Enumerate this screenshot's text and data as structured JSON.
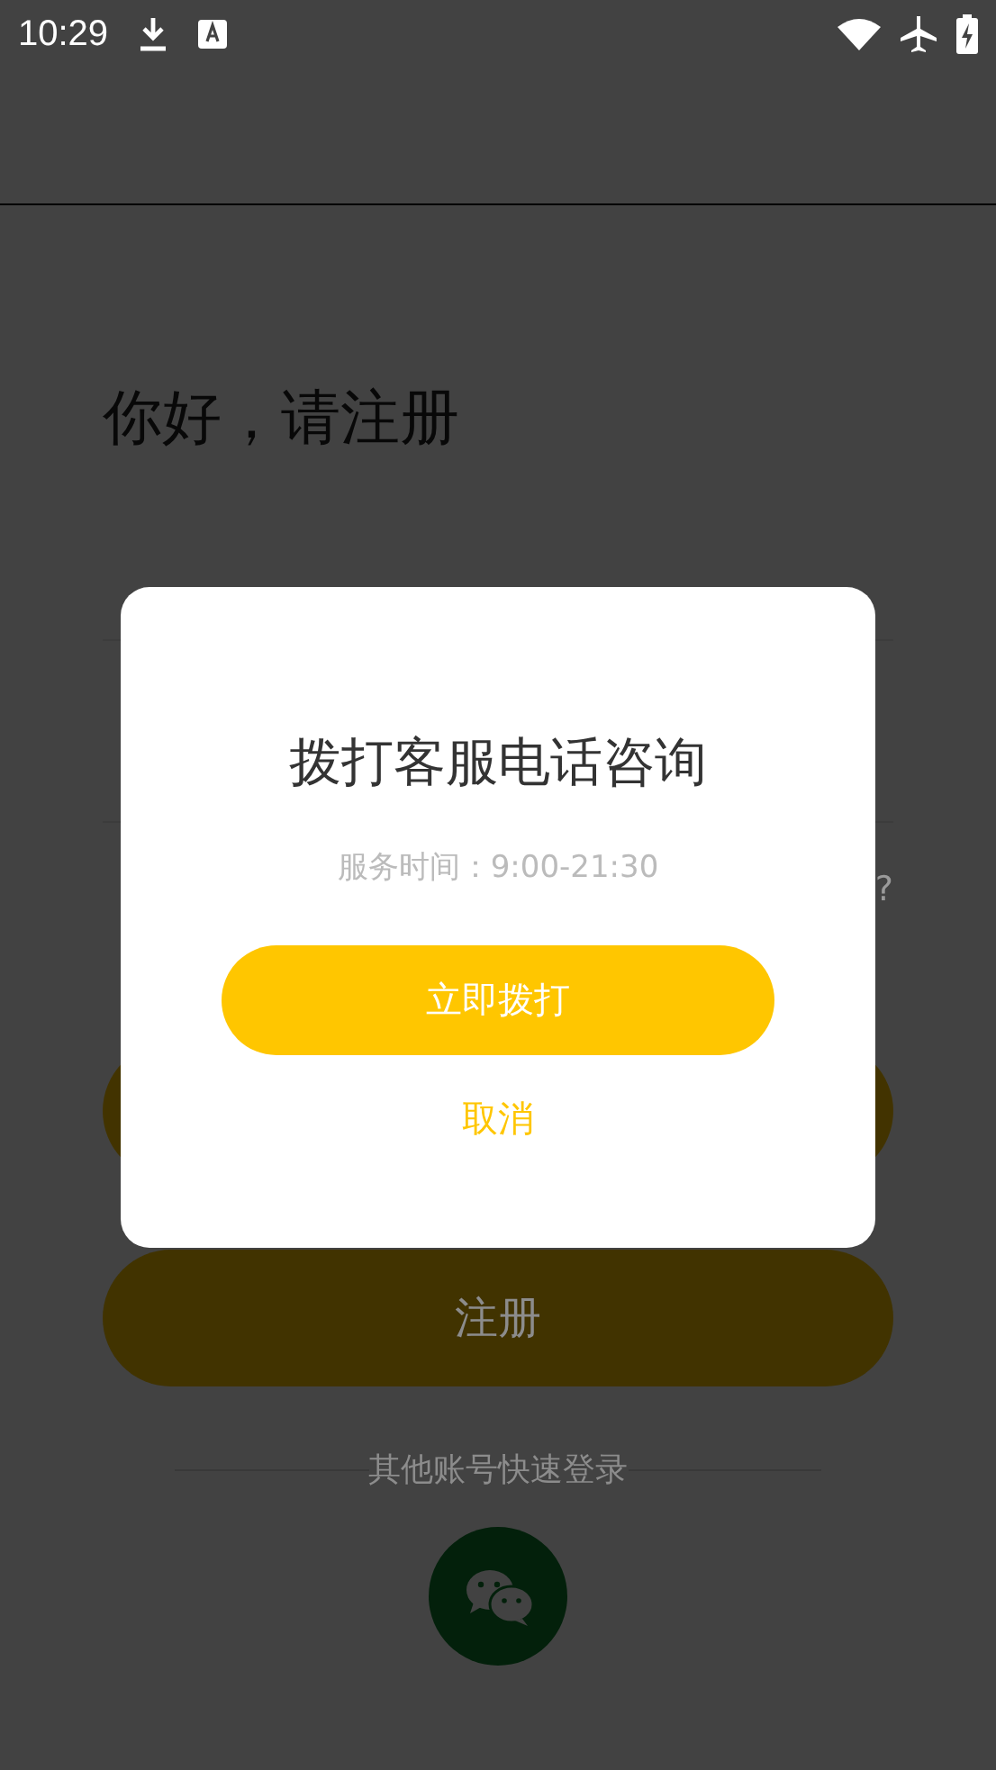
{
  "status_bar": {
    "time": "10:29"
  },
  "title": "你好，请注册",
  "forgot_link": "?",
  "register_button": "注册",
  "other_login": "其他账号快速登录",
  "dialog": {
    "title": "拨打客服电话咨询",
    "subtitle": "服务时间：9:00-21:30",
    "call_button": "立即拨打",
    "cancel_button": "取消"
  }
}
